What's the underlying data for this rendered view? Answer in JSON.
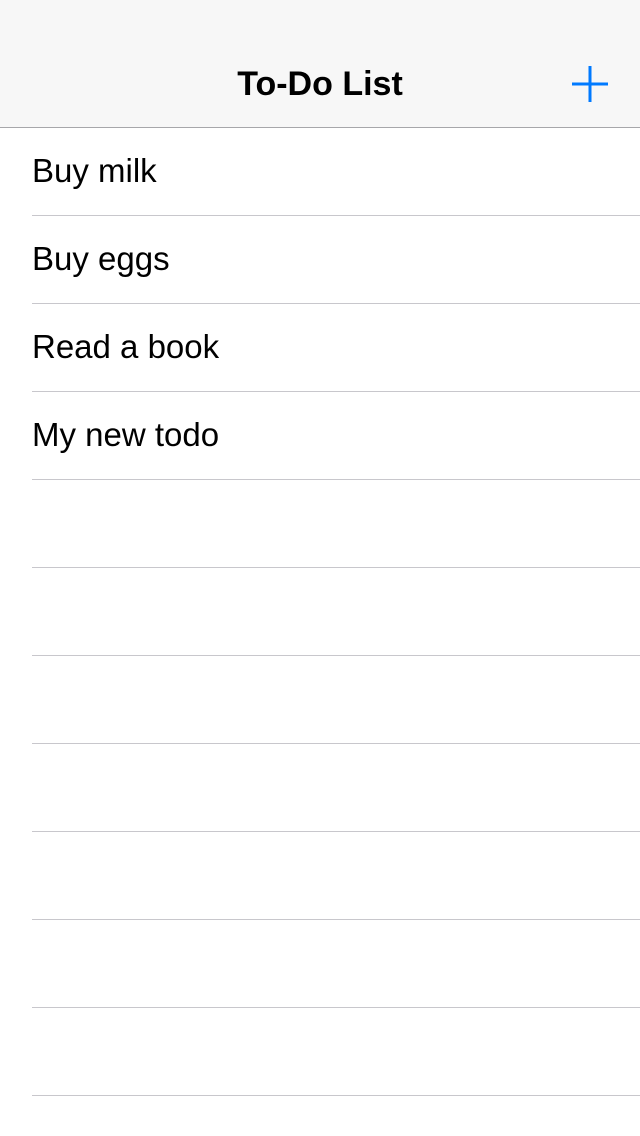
{
  "navbar": {
    "title": "To-Do List",
    "add_button_icon": "plus-icon",
    "accent_color": "#007aff"
  },
  "todos": [
    {
      "label": "Buy milk"
    },
    {
      "label": "Buy eggs"
    },
    {
      "label": "Read a book"
    },
    {
      "label": "My new todo"
    }
  ],
  "empty_row_count": 7
}
